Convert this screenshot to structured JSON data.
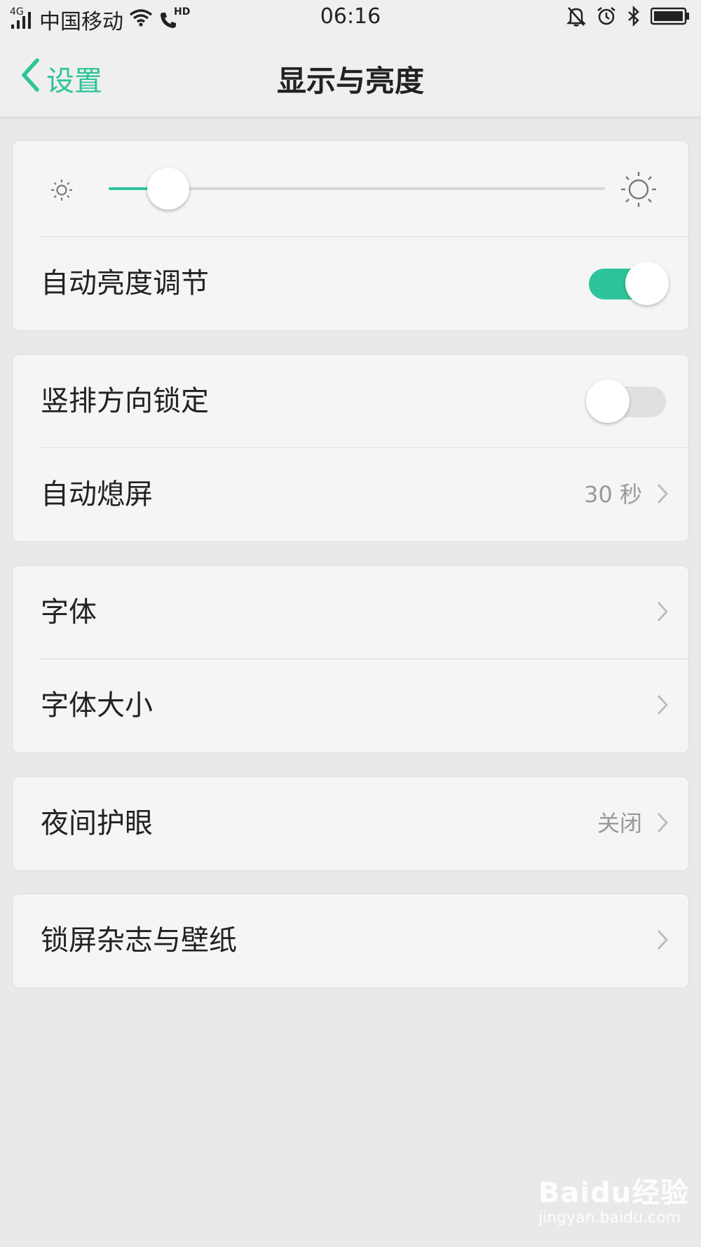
{
  "status_bar": {
    "network": "4G",
    "carrier": "中国移动",
    "hd": "HD",
    "time": "06:16"
  },
  "nav": {
    "back_label": "设置",
    "title": "显示与亮度"
  },
  "accent_color": "#2ec49a",
  "brightness": {
    "level": 0.12
  },
  "auto_brightness": {
    "label": "自动亮度调节",
    "enabled": true
  },
  "orientation_lock": {
    "label": "竖排方向锁定",
    "enabled": false
  },
  "auto_sleep": {
    "label": "自动熄屏",
    "value": "30 秒"
  },
  "font": {
    "label": "字体"
  },
  "font_size": {
    "label": "字体大小"
  },
  "night_mode": {
    "label": "夜间护眼",
    "value": "关闭"
  },
  "lockscreen": {
    "label": "锁屏杂志与壁纸"
  },
  "watermark": {
    "main": "Baidu经验",
    "sub": "jingyan.baidu.com"
  }
}
